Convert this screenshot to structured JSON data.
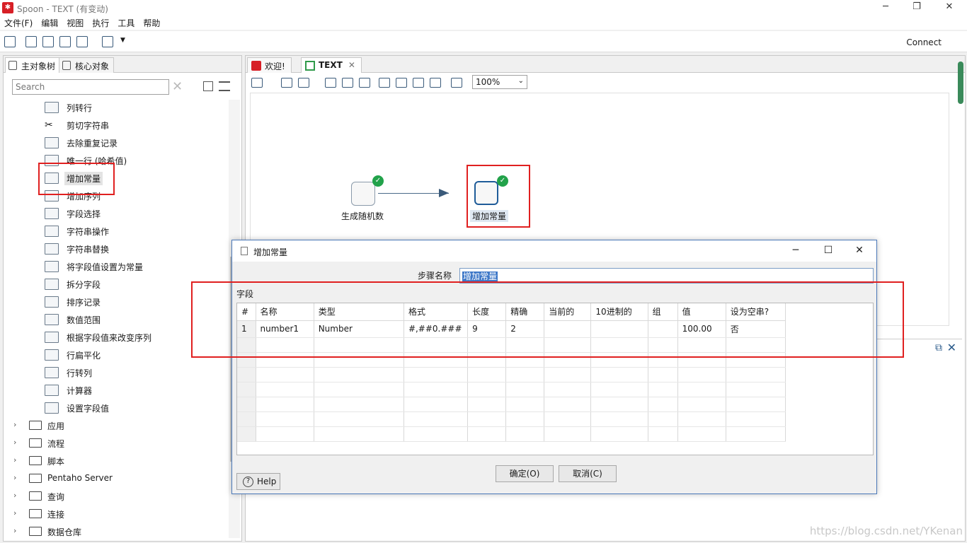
{
  "window": {
    "title": "Spoon - TEXT (有变动)"
  },
  "menu": [
    "文件(F)",
    "编辑",
    "视图",
    "执行",
    "工具",
    "帮助"
  ],
  "toolbar": {
    "connect": "Connect"
  },
  "left": {
    "tabs": [
      "主对象树",
      "核心对象"
    ],
    "search_placeholder": "Search",
    "steps": [
      "列转行",
      "剪切字符串",
      "去除重复记录",
      "唯一行 (哈希值)",
      "增加常量",
      "增加序列",
      "字段选择",
      "字符串操作",
      "字符串替换",
      "将字段值设置为常量",
      "拆分字段",
      "排序记录",
      "数值范围",
      "根据字段值来改变序列",
      "行扁平化",
      "行转列",
      "计算器",
      "设置字段值"
    ],
    "folders": [
      "应用",
      "流程",
      "脚本",
      "Pentaho Server",
      "查询",
      "连接",
      "数据仓库"
    ]
  },
  "right": {
    "tabs": [
      "欢迎!",
      "TEXT"
    ],
    "zoom": "100%",
    "canvas_steps": [
      {
        "label": "生成随机数"
      },
      {
        "label": "增加常量"
      }
    ]
  },
  "dialog": {
    "title": "增加常量",
    "stepname_label": "步骤名称",
    "stepname_value": "增加常量",
    "fields_label": "字段",
    "columns": [
      "#",
      "名称",
      "类型",
      "格式",
      "长度",
      "精确",
      "当前的",
      "10进制的",
      "组",
      "值",
      "设为空串?"
    ],
    "rows": [
      [
        "1",
        "number1",
        "Number",
        "#,##0.###",
        "9",
        "2",
        "",
        "",
        "",
        "100.00",
        "否"
      ]
    ],
    "ok_label": "确定(O)",
    "cancel_label": "取消(C)",
    "help_label": "Help"
  },
  "watermark": "https://blog.csdn.net/YKenan"
}
